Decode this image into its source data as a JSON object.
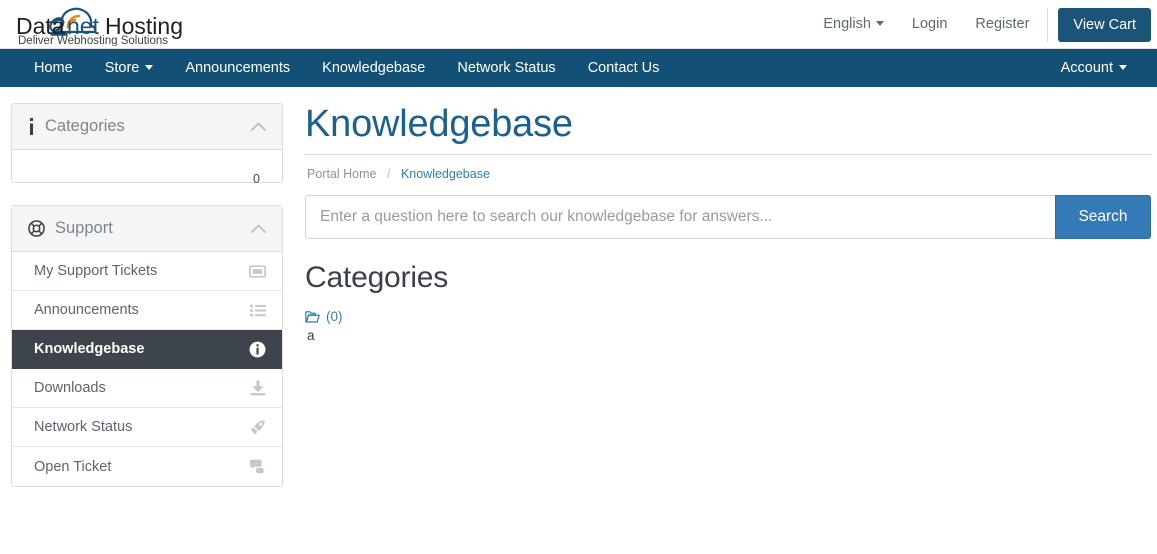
{
  "brand": {
    "name_part1": "Data",
    "name_digit": "2",
    "name_part2": "net",
    "name_part3": "Hosting",
    "tagline": "Deliver Webhosting Solutions",
    "logo_blue": "#1b5478",
    "logo_orange": "#ef8421"
  },
  "colors": {
    "navbar_blue": "#125175",
    "button_blue": "#1b5478",
    "search_blue": "#337ab7",
    "link_blue": "#2f7fae",
    "title_blue": "#1c6090",
    "active_dark": "#3e444c"
  },
  "topbar": {
    "language_label": "English",
    "login_label": "Login",
    "register_label": "Register",
    "cart_label": "View Cart",
    "language_icon": "chevron-down-icon"
  },
  "navbar": {
    "items": [
      {
        "label": "Home",
        "has_caret": false
      },
      {
        "label": "Store",
        "has_caret": true
      },
      {
        "label": "Announcements",
        "has_caret": false
      },
      {
        "label": "Knowledgebase",
        "has_caret": false
      },
      {
        "label": "Network Status",
        "has_caret": false
      },
      {
        "label": "Contact Us",
        "has_caret": false
      }
    ],
    "account_label": "Account",
    "account_icon": "chevron-down-icon"
  },
  "sidebar": {
    "categories_panel": {
      "title": "Categories",
      "icon": "info-i-icon",
      "collapse_icon": "chevron-up-icon",
      "count": "0"
    },
    "support_panel": {
      "title": "Support",
      "icon": "lifebuoy-icon",
      "collapse_icon": "chevron-up-icon",
      "items": [
        {
          "label": "My Support Tickets",
          "icon": "ticket-icon",
          "active": false
        },
        {
          "label": "Announcements",
          "icon": "list-icon",
          "active": false
        },
        {
          "label": "Knowledgebase",
          "icon": "info-circle-icon",
          "active": true
        },
        {
          "label": "Downloads",
          "icon": "download-icon",
          "active": false
        },
        {
          "label": "Network Status",
          "icon": "rocket-icon",
          "active": false
        },
        {
          "label": "Open Ticket",
          "icon": "comments-icon",
          "active": false
        }
      ]
    }
  },
  "main": {
    "page_title": "Knowledgebase",
    "breadcrumb": {
      "home_label": "Portal Home",
      "separator": "/",
      "current_label": "Knowledgebase"
    },
    "search": {
      "placeholder": "Enter a question here to search our knowledgebase for answers...",
      "value": "",
      "button_label": "Search"
    },
    "categories_section": {
      "heading": "Categories",
      "items": [
        {
          "icon": "folder-open-icon",
          "name": "",
          "count_label": "(0)",
          "description": "a"
        }
      ]
    }
  }
}
